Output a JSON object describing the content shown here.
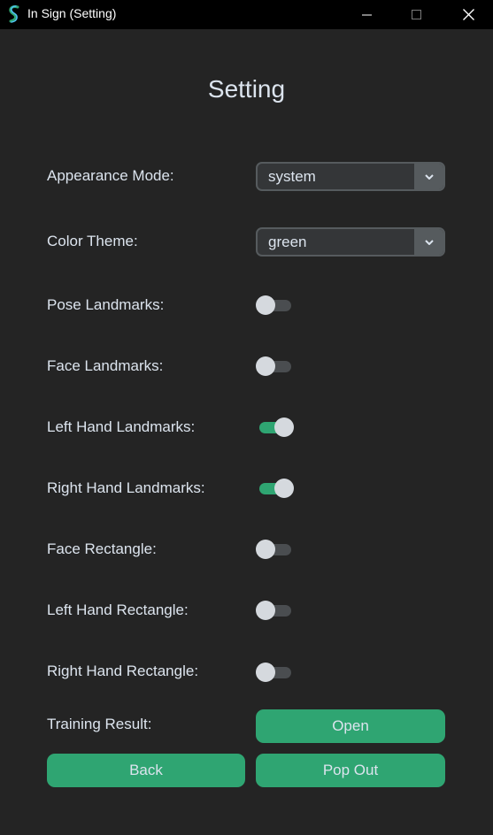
{
  "window": {
    "title": "In Sign (Setting)",
    "minimize_glyph": "—",
    "maximize_glyph": "☐",
    "close_glyph": "✕"
  },
  "page": {
    "title": "Setting"
  },
  "appearance": {
    "label": "Appearance Mode:",
    "value": "system"
  },
  "color_theme": {
    "label": "Color Theme:",
    "value": "green"
  },
  "switches": [
    {
      "label": "Pose Landmarks:",
      "on": false
    },
    {
      "label": "Face Landmarks:",
      "on": false
    },
    {
      "label": "Left Hand Landmarks:",
      "on": true
    },
    {
      "label": "Right Hand Landmarks:",
      "on": true
    },
    {
      "label": "Face Rectangle:",
      "on": false
    },
    {
      "label": "Left Hand Rectangle:",
      "on": false
    },
    {
      "label": "Right Hand Rectangle:",
      "on": false
    }
  ],
  "training": {
    "label": "Training Result:",
    "open_label": "Open"
  },
  "buttons": {
    "back_label": "Back",
    "pop_out_label": "Pop Out"
  },
  "colors": {
    "accent": "#2fa572",
    "background": "#242424",
    "titlebar": "#000000",
    "text": "#dce4ee"
  }
}
